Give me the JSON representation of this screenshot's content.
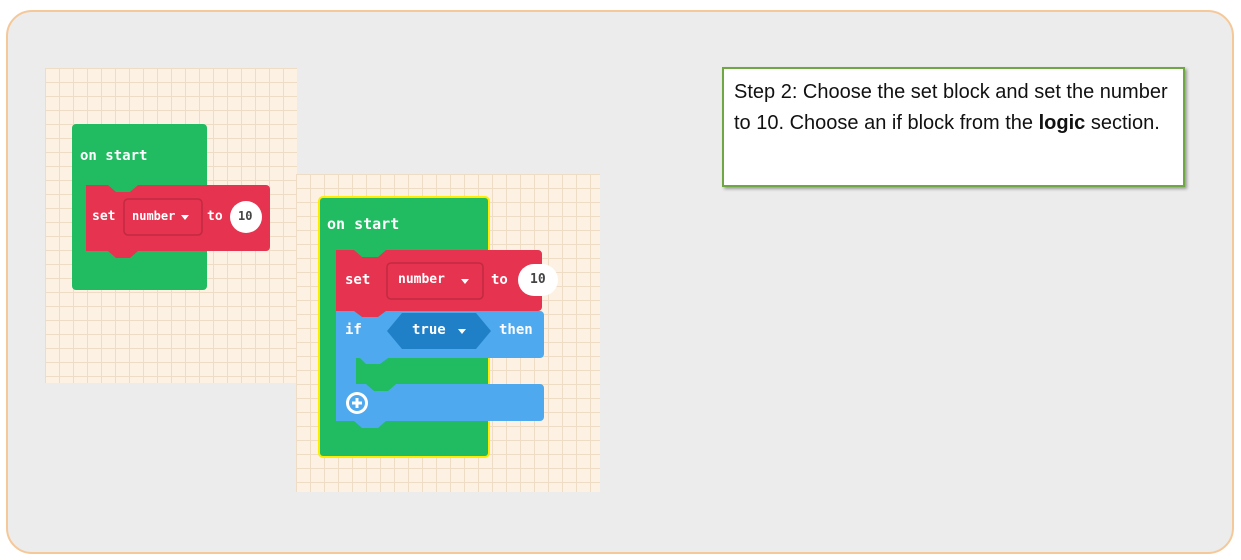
{
  "callout": {
    "part1": "Step 2: Choose the set block and set the number to 10. Choose an if block from the ",
    "bold": "logic",
    "part2": " section."
  },
  "left_workspace": {
    "on_start": "on start",
    "set": "set",
    "variable": "number",
    "to": "to",
    "value": "10"
  },
  "right_workspace": {
    "on_start": "on start",
    "set": "set",
    "variable": "number",
    "to": "to",
    "value": "10",
    "if": "if",
    "condition": "true",
    "then": "then"
  },
  "colors": {
    "green": "#21bb62",
    "red": "#e6334f",
    "blue": "#4fa9ee",
    "selection": "#ffeb00"
  },
  "icons": [
    "chevron-down-icon",
    "plus-circle-icon"
  ]
}
